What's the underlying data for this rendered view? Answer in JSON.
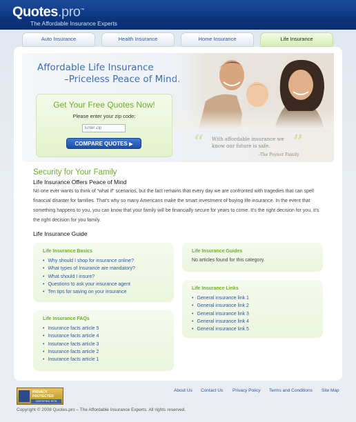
{
  "header": {
    "logo_main": "Quotes",
    "logo_ext": ".pro",
    "logo_tm": "™",
    "tagline": "The Affordable Insurance Experts"
  },
  "tabs": [
    {
      "label": "Auto Insurance"
    },
    {
      "label": "Health Insurance"
    },
    {
      "label": "Home Insurance"
    },
    {
      "label": "Life Insurance",
      "active": true
    }
  ],
  "hero": {
    "title_line1": "Affordable Life Insurance",
    "title_line2": "–Priceless Peace of Mind."
  },
  "quote_box": {
    "title": "Get Your Free Quotes Now!",
    "prompt": "Please enter your zip code:",
    "zip_placeholder": "Enter Zip",
    "button_label": "COMPARE QUOTES"
  },
  "testimonial": {
    "open_quote": "“",
    "close_quote": "”",
    "text": "With affordable insurance we know our future is safe.",
    "author": "-The Poynor Family"
  },
  "security": {
    "title": "Security for Your Family",
    "subtitle": "Life Insurance Offers Peace of Mind",
    "body": "No one ever wants to think of “what if” scenarios, but the fact remains that every day we are confronted with tragedies that can spell financial disaster for families. That's why so many Americans make the smart investment of buying life insurance. In the event that something happens to you, you can know that your family will be financially secure for years to come. It's the right decision for you, it's the right decision for you family."
  },
  "guide": {
    "title": "Life Insurance Guide",
    "basics": {
      "title": "Life Insurance Basics",
      "items": [
        "Why should I shop for insurance online?",
        "What types of Insurance are mandatory?",
        "What should I insure?",
        "Questions to ask your insurance agent",
        "Ten tips for saving on your insurance"
      ]
    },
    "guides": {
      "title": "Life Insurance Guides",
      "note": "No articles found for this category."
    },
    "links": {
      "title": "Life Insurance Links",
      "items": [
        "General insurance link 1",
        "General insurance link 2",
        "General insurance link 3",
        "General insurance link 4",
        "General insurance link 5"
      ]
    },
    "faqs": {
      "title": "Life Insurance FAQs",
      "items": [
        "Insurance facts article 5",
        "Insurance facts article 4",
        "Insurance facts article 3",
        "Insurance facts article 2",
        "Insurance facts article 1"
      ]
    }
  },
  "footer": {
    "badge_line1": "PRIVACY",
    "badge_line2": "PROTECTED",
    "badge_line3": "CERTIFIED SITE",
    "links": [
      "About Us",
      "Contact Us",
      "Privacy Policy",
      "Terms and Conditions",
      "Site Map"
    ],
    "copyright": "Copyright © 2008 Quotes.pro – The Affordable Insurance Experts. All rights reserved."
  },
  "colors": {
    "header_blue": "#0c3580",
    "accent_green": "#6cae2b",
    "link_blue": "#2a55a8"
  }
}
